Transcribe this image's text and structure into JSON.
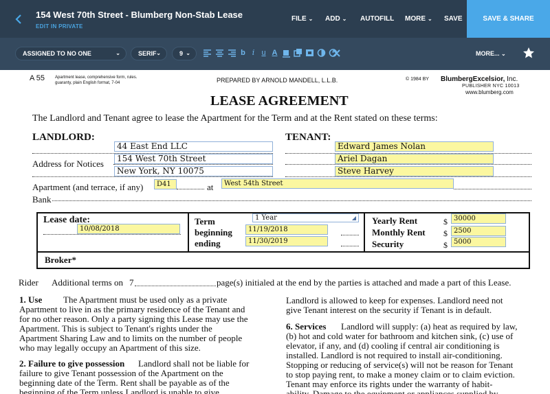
{
  "header": {
    "title": "154 West 70th Street - Blumberg Non-Stab Lease",
    "subtitle": "EDIT IN PRIVATE",
    "menu": [
      {
        "label": "FILE"
      },
      {
        "label": "ADD"
      },
      {
        "label": "AUTOFILL"
      },
      {
        "label": "MORE"
      },
      {
        "label": "SAVE"
      }
    ],
    "save_share": "SAVE & SHARE"
  },
  "toolbar": {
    "assigned": "ASSIGNED TO NO ONE",
    "font": "SERIF",
    "size": "9",
    "more": "MORE...",
    "icons": [
      "align-left-icon",
      "align-center-icon",
      "align-right-icon",
      "bold-icon",
      "italic-icon",
      "underline-icon",
      "text-color-icon",
      "highlight-icon",
      "copy-icon",
      "duplicate-icon",
      "opacity-icon",
      "timer-icon",
      "delete-icon"
    ]
  },
  "form": {
    "form_no": "A 55",
    "form_desc1": "Apartment lease, comprehensive form, rules.",
    "form_desc2": "guaranty, plain English format, 7-04",
    "prepared": "PREPARED BY ARNOLD MANDELL, L.L.B.",
    "copyright": "© 1984 BY",
    "publisher_brand": "BlumbergExcelsior,",
    "publisher_inc": "Inc.",
    "publisher_city": "PUBLISHER NYC 10013",
    "publisher_web": "www.blumberg.com",
    "title": "LEASE AGREEMENT",
    "intro": "The Landlord and Tenant agree to lease the Apartment for the Term and at the Rent stated on these terms:",
    "landlord_label": "LANDLORD:",
    "tenant_label": "TENANT:",
    "address_label": "Address for Notices",
    "apartment_label": "Apartment (and terrace, if any)",
    "at_label": "at",
    "bank_label": "Bank",
    "landlord_name": "44 East End LLC",
    "landlord_address1": "154 West 70th Street",
    "landlord_address2": "New York, NY 10075",
    "tenant1": "Edward James Nolan",
    "tenant2": "Ariel Dagan",
    "tenant3": "Steve Harvey",
    "apartment_no": "D41",
    "apartment_street": "West 54th Street",
    "lease_date_label": "Lease date:",
    "lease_date": "10/08/2018",
    "term_label": "Term",
    "term_value": "1 Year",
    "beginning_label": "beginning",
    "beginning_value": "11/19/2018",
    "ending_label": "ending",
    "ending_value": "11/30/2019",
    "yearly_rent_label": "Yearly Rent",
    "yearly_rent": "30000",
    "monthly_rent_label": "Monthly Rent",
    "monthly_rent": "2500",
    "security_label": "Security",
    "security": "5000",
    "dollar": "$",
    "broker_label": "Broker*",
    "rider_label": "Rider",
    "rider_text_a": "Additional terms on",
    "rider_pages": "7",
    "rider_text_b": "page(s) initialed at  the end by the parties is attached and made a part of this Lease.",
    "left_col": [
      "1. Use",
      "The Apartment must be used only as a private",
      "Apartment to live in as the primary residence of the Tenant and",
      "for  no other reason. Only a party signing this Lease may use the",
      "Apartment.  This  is  subject  to  Tenant's  rights  under  the",
      "Apartment Sharing Law and to limits on the number of people",
      "who may legally occupy an Apartment of this size.",
      "2. Failure to give possession",
      "Landlord shall not be liable for",
      "failure to give Tenant possession of the Apartment on the",
      "beginning date of the Term. Rent shall be payable as of the",
      "beginning of the Term unless Landlord is unable to give"
    ],
    "right_col": [
      "Landlord is allowed to keep for expenses. Landlord need not",
      "give Tenant interest on the security if Tenant is in default.",
      "6. Services",
      "Landlord will supply: (a) heat as required by law,",
      "(b) hot and cold water for bathroom and kitchen sink, (c) use of",
      "elevator, if any, and (d) cooling if central air conditioning is",
      "installed. Landlord is not required to install air-conditioning.",
      "Stopping or reducing of service(s) will not be reason for Tenant",
      "to stop paying rent, to make a money claim or to claim eviction.",
      "Tenant may enforce its rights under the warranty of habit-",
      "ability. Damage to the equipment or appliances supplied by"
    ]
  }
}
